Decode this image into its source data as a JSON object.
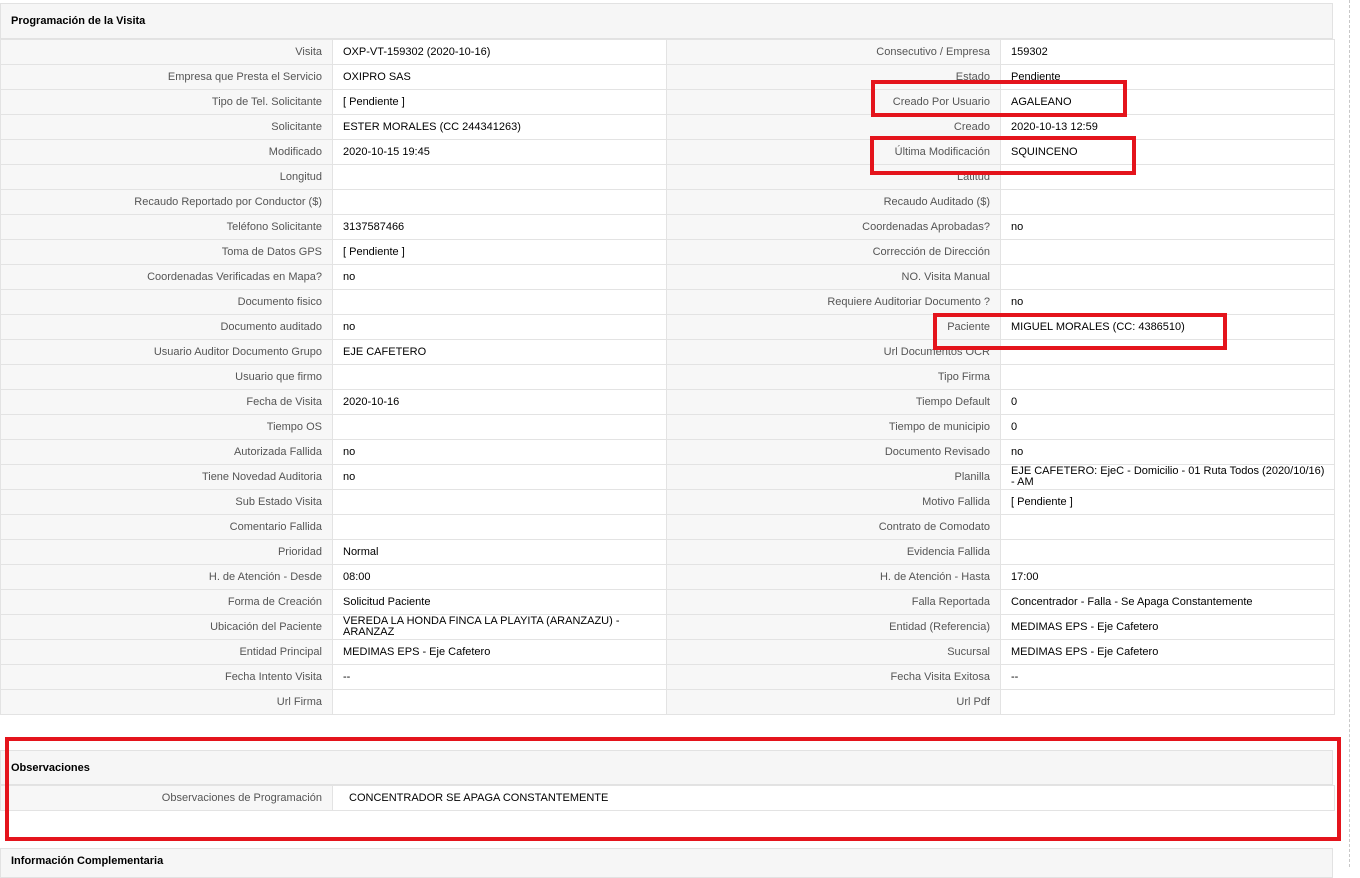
{
  "sections": {
    "programacion": "Programación de la Visita",
    "observaciones": "Observaciones",
    "info_complementaria": "Información Complementaria"
  },
  "rows": [
    {
      "l1": "Visita",
      "v1": "OXP-VT-159302 (2020-10-16)",
      "l2": "Consecutivo / Empresa",
      "v2": "159302"
    },
    {
      "l1": "Empresa que Presta el Servicio",
      "v1": "OXIPRO SAS",
      "l2": "Estado",
      "v2": "Pendiente"
    },
    {
      "l1": "Tipo de Tel. Solicitante",
      "v1": "[ Pendiente ]",
      "l2": "Creado Por Usuario",
      "v2": "AGALEANO"
    },
    {
      "l1": "Solicitante",
      "v1": "ESTER MORALES (CC 244341263)",
      "l2": "Creado",
      "v2": "2020-10-13 12:59"
    },
    {
      "l1": "Modificado",
      "v1": "2020-10-15 19:45",
      "l2": "Última Modificación",
      "v2": " SQUINCENO"
    },
    {
      "l1": "Longitud",
      "v1": "",
      "l2": "Latitud",
      "v2": ""
    },
    {
      "l1": "Recaudo Reportado por Conductor ($)",
      "v1": "",
      "l2": "Recaudo Auditado ($)",
      "v2": ""
    },
    {
      "l1": "Teléfono Solicitante",
      "v1": "3137587466",
      "l2": "Coordenadas Aprobadas?",
      "v2": " no"
    },
    {
      "l1": "Toma de Datos GPS",
      "v1": "[ Pendiente ]",
      "l2": "Corrección de Dirección",
      "v2": ""
    },
    {
      "l1": "Coordenadas Verificadas en Mapa?",
      "v1": " no",
      "l2": "NO. Visita Manual",
      "v2": ""
    },
    {
      "l1": "Documento fisico",
      "v1": "",
      "l2": "Requiere Auditoriar Documento ?",
      "v2": " no"
    },
    {
      "l1": "Documento auditado",
      "v1": " no",
      "l2": "Paciente",
      "v2": "MIGUEL MORALES (CC: 4386510)"
    },
    {
      "l1": "Usuario Auditor Documento Grupo",
      "v1": "EJE CAFETERO",
      "l2": "Url Documentos OCR",
      "v2": ""
    },
    {
      "l1": "Usuario que firmo",
      "v1": "",
      "l2": "Tipo Firma",
      "v2": ""
    },
    {
      "l1": "Fecha de Visita",
      "v1": " 2020-10-16",
      "l2": "Tiempo Default",
      "v2": "0"
    },
    {
      "l1": "Tiempo OS",
      "v1": "",
      "l2": "Tiempo de municipio",
      "v2": "0"
    },
    {
      "l1": "Autorizada Fallida",
      "v1": " no",
      "l2": "Documento Revisado",
      "v2": " no"
    },
    {
      "l1": "Tiene Novedad Auditoria",
      "v1": " no",
      "l2": "Planilla",
      "v2": "EJE CAFETERO: EjeC - Domicilio - 01 Ruta Todos (2020/10/16) - AM"
    },
    {
      "l1": "Sub Estado Visita",
      "v1": "",
      "l2": "Motivo Fallida",
      "v2": "[ Pendiente ]"
    },
    {
      "l1": "Comentario Fallida",
      "v1": "",
      "l2": "Contrato de Comodato",
      "v2": ""
    },
    {
      "l1": "Prioridad",
      "v1": "Normal",
      "l2": "Evidencia Fallida",
      "v2": ""
    },
    {
      "l1": "H. de Atención - Desde",
      "v1": "08:00",
      "l2": "H. de Atención - Hasta",
      "v2": "17:00"
    },
    {
      "l1": "Forma de Creación",
      "v1": "Solicitud Paciente",
      "l2": "Falla Reportada",
      "v2": "Concentrador - Falla - Se Apaga Constantemente"
    },
    {
      "l1": "Ubicación del Paciente",
      "v1": "VEREDA LA HONDA FINCA LA PLAYITA (ARANZAZU) - ARANZAZ",
      "l2": "Entidad (Referencia)",
      "v2": "MEDIMAS EPS - Eje Cafetero"
    },
    {
      "l1": "Entidad Principal",
      "v1": "MEDIMAS EPS - Eje Cafetero",
      "l2": "Sucursal",
      "v2": "MEDIMAS EPS - Eje Cafetero"
    },
    {
      "l1": "Fecha Intento Visita",
      "v1": " --",
      "l2": "Fecha Visita Exitosa",
      "v2": " --"
    },
    {
      "l1": "Url Firma",
      "v1": "",
      "l2": "Url Pdf",
      "v2": ""
    }
  ],
  "observaciones": {
    "label": "Observaciones de Programación",
    "value": "CONCENTRADOR SE APAGA CONSTANTEMENTE"
  },
  "highlight_color": "#e4141c"
}
